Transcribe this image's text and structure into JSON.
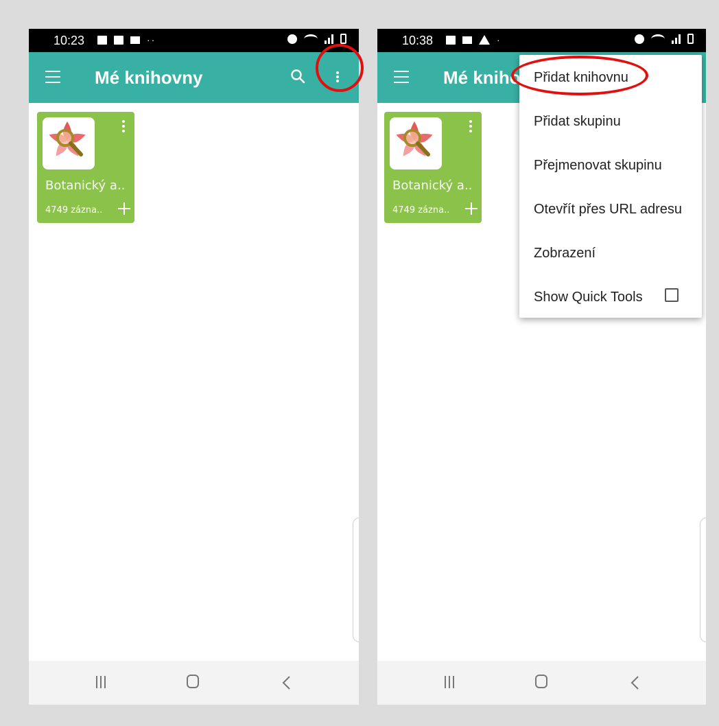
{
  "left_screen": {
    "status": {
      "time": "10:23"
    },
    "appbar": {
      "title": "Mé knihovny"
    },
    "library_card": {
      "title": "Botanický a..",
      "count": "4749 zázna.."
    }
  },
  "right_screen": {
    "status": {
      "time": "10:38"
    },
    "appbar": {
      "title": "Mé knihovny"
    },
    "library_card": {
      "title": "Botanický a..",
      "count": "4749 zázna.."
    },
    "overflow_menu": {
      "items": [
        "Přidat knihovnu",
        "Přidat skupinu",
        "Přejmenovat skupinu",
        "Otevřít přes URL adresu",
        "Zobrazení",
        "Show Quick Tools"
      ],
      "show_quick_tools_checked": false
    }
  },
  "colors": {
    "appbar": "#38b0a3",
    "card": "#8bc34a",
    "highlight": "#e01010",
    "statusbar": "#000000"
  },
  "icons": [
    "hamburger-icon",
    "search-icon",
    "more-vert-icon",
    "plus-icon",
    "recent-apps-icon",
    "home-icon",
    "back-icon",
    "flower-magnifier-logo"
  ]
}
